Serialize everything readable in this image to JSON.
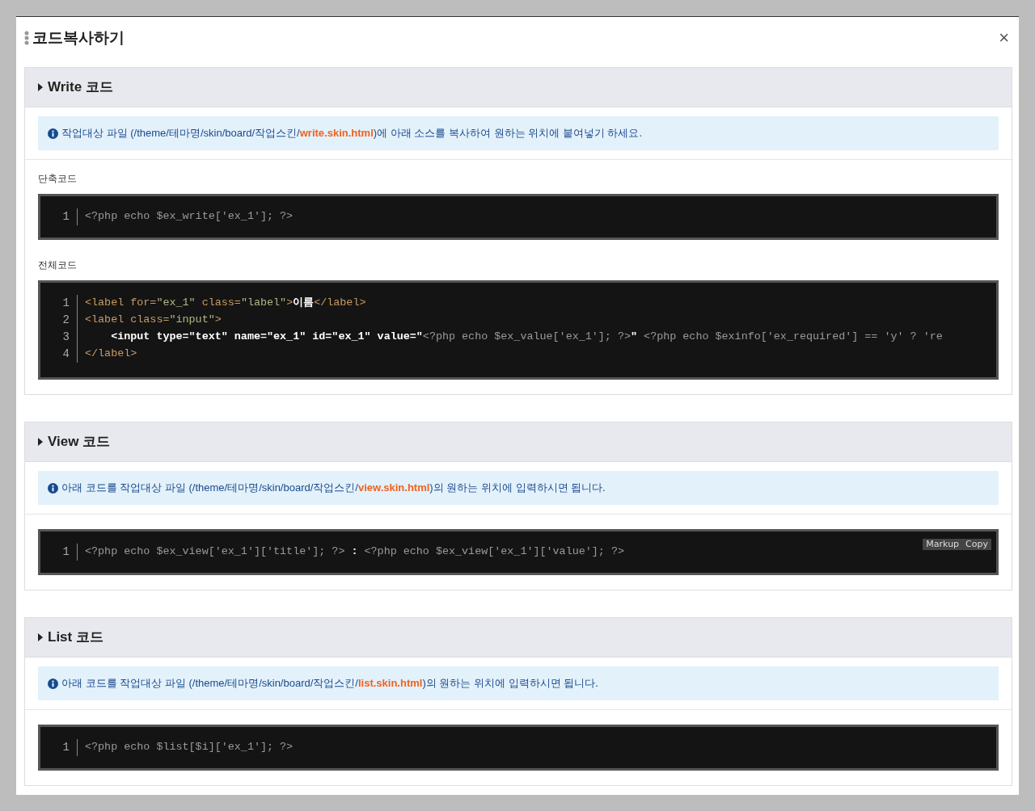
{
  "dialog": {
    "title": "코드복사하기",
    "close": "×"
  },
  "sections": [
    {
      "title": "Write 코드",
      "notice": [
        {
          "kind": "text",
          "text": "작업대상 파일 (/theme/테마명/skin/board/작업스킨/"
        },
        {
          "kind": "file",
          "text": "write.skin.html"
        },
        {
          "kind": "text",
          "text": ")에 아래 소스를 복사하여 원하는 위치에 붙여넣기 하세요."
        }
      ],
      "blocks": [
        {
          "label": "단축코드",
          "lines": [
            {
              "number": "1",
              "tokens": [
                {
                  "kind": "php",
                  "text": "<?php echo $ex_write['ex_1']; ?>"
                }
              ]
            }
          ]
        },
        {
          "label": "전체코드",
          "lines": [
            {
              "number": "1",
              "tokens": [
                {
                  "kind": "tag",
                  "text": "<label for="
                },
                {
                  "kind": "string",
                  "text": "\"ex_1\""
                },
                {
                  "kind": "tag",
                  "text": " class="
                },
                {
                  "kind": "string",
                  "text": "\"label\""
                },
                {
                  "kind": "tag",
                  "text": ">"
                },
                {
                  "kind": "plain",
                  "text": "이름"
                },
                {
                  "kind": "tag",
                  "text": "</label>"
                }
              ]
            },
            {
              "number": "2",
              "tokens": [
                {
                  "kind": "tag",
                  "text": "<label class="
                },
                {
                  "kind": "string",
                  "text": "\"input\""
                },
                {
                  "kind": "tag",
                  "text": ">"
                }
              ]
            },
            {
              "number": "3",
              "tokens": [
                {
                  "kind": "plain",
                  "text": "    <input type=\"text\" name=\"ex_1\" id=\"ex_1\" value=\""
                },
                {
                  "kind": "php",
                  "text": "<?php echo $ex_value['ex_1']; ?>"
                },
                {
                  "kind": "plain",
                  "text": "\""
                },
                {
                  "kind": "php",
                  "text": " <?php echo $exinfo['ex_required'] == 'y' ? 're"
                }
              ]
            },
            {
              "number": "4",
              "tokens": [
                {
                  "kind": "tag",
                  "text": "</label>"
                }
              ]
            }
          ]
        }
      ]
    },
    {
      "title": "View 코드",
      "notice": [
        {
          "kind": "text",
          "text": "아래 코드를 작업대상 파일 (/theme/테마명/skin/board/작업스킨/"
        },
        {
          "kind": "file",
          "text": "view.skin.html"
        },
        {
          "kind": "text",
          "text": ")의 원하는 위치에 입력하시면 됩니다."
        }
      ],
      "blocks": [
        {
          "toolbar": [
            "Markup",
            "Copy"
          ],
          "lines": [
            {
              "number": "1",
              "tokens": [
                {
                  "kind": "php",
                  "text": "<?php echo $ex_view['ex_1']['title']; ?>"
                },
                {
                  "kind": "plain",
                  "text": " : "
                },
                {
                  "kind": "php",
                  "text": "<?php echo $ex_view['ex_1']['value']; ?>"
                }
              ]
            }
          ]
        }
      ]
    },
    {
      "title": "List 코드",
      "notice": [
        {
          "kind": "text",
          "text": "아래 코드를 작업대상 파일 (/theme/테마명/skin/board/작업스킨/"
        },
        {
          "kind": "file",
          "text": "list.skin.html"
        },
        {
          "kind": "text",
          "text": ")의 원하는 위치에 입력하시면 됩니다."
        }
      ],
      "blocks": [
        {
          "lines": [
            {
              "number": "1",
              "tokens": [
                {
                  "kind": "php",
                  "text": "<?php echo $list[$i]['ex_1']; ?>"
                }
              ]
            }
          ]
        }
      ]
    }
  ]
}
